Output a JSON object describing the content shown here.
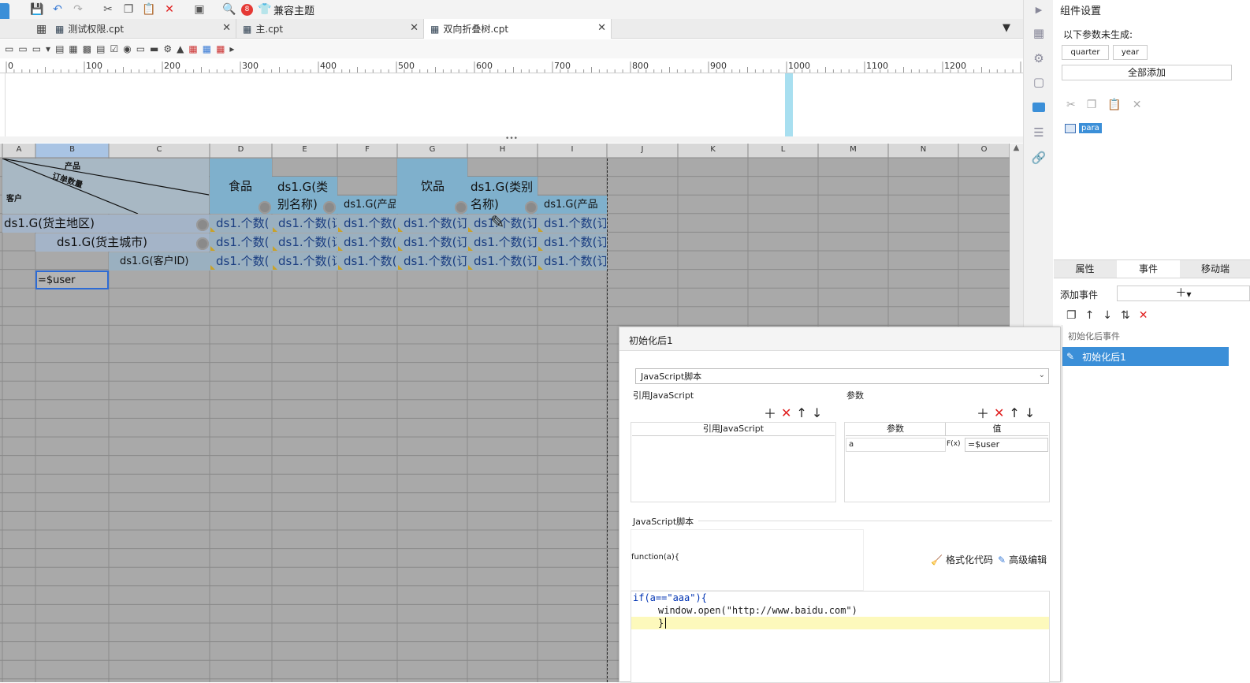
{
  "toolbar": {
    "theme_label": "兼容主题",
    "badge": "8"
  },
  "tabs": [
    {
      "label": "测试权限.cpt"
    },
    {
      "label": "主.cpt"
    },
    {
      "label": "双向折叠树.cpt"
    }
  ],
  "ruler": {
    "ticks": [
      "0",
      "100",
      "200",
      "300",
      "400",
      "500",
      "600",
      "700",
      "800",
      "900",
      "1000",
      "1100",
      "1200"
    ]
  },
  "columns": [
    "A",
    "B",
    "C",
    "D",
    "E",
    "F",
    "G",
    "H",
    "I",
    "J",
    "K",
    "L",
    "M",
    "N",
    "O"
  ],
  "header_cells": {
    "product": "产品",
    "order_qty": "订单数量",
    "customer": "客户",
    "food": "食品",
    "drink": "饮品",
    "cat1": "ds1.G(类别名称)",
    "cat2": "ds1.G(类别名称)",
    "prod1": "ds1.G(产品",
    "prod2": "ds1.G(产品",
    "region": "ds1.G(货主地区)",
    "city": "ds1.G(货主城市)",
    "cust_id": "ds1.G(客户ID)",
    "user_formula": "=$user",
    "count_short": "ds1.个数(",
    "count_long": "ds1.个数(订"
  },
  "right_panel": {
    "title": "组件设置",
    "not_generated": "以下参数未生成:",
    "params": [
      "quarter",
      "year"
    ],
    "add_all": "全部添加",
    "widget": "para",
    "tabs": [
      "属性",
      "事件",
      "移动端"
    ],
    "add_event": "添加事件",
    "event_group": "初始化后事件",
    "event_item": "初始化后1"
  },
  "dialog": {
    "title": "初始化后1",
    "type_select": "JavaScript脚本",
    "ref_js_label": "引用JavaScript",
    "params_label": "参数",
    "ref_js_header": "引用JavaScript",
    "param_header": "参数",
    "value_header": "值",
    "param_name": "a",
    "fx": "F(x)",
    "param_value": "=$user",
    "js_label": "JavaScript脚本",
    "func_sig": "function(a){",
    "format_code": "格式化代码",
    "advanced_edit": "高级编辑",
    "code_line1": "if(a==\"aaa\"){",
    "code_line2": "window.open(\"http://www.baidu.com\")",
    "code_line3": "}"
  }
}
